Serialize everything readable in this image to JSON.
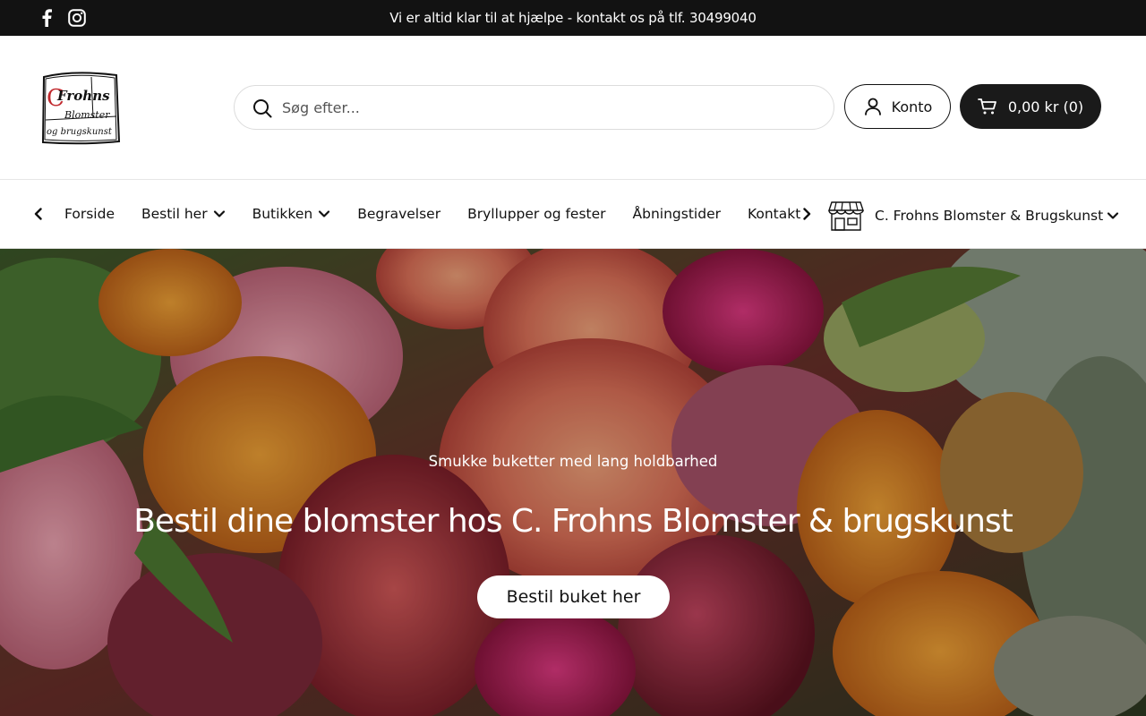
{
  "topbar": {
    "announcement": "Vi er altid klar til at hjælpe - kontakt os på tlf. 30499040",
    "social": [
      "facebook-icon",
      "instagram-icon"
    ],
    "background": "#121212"
  },
  "header": {
    "logo": {
      "line1": "Frohns",
      "line2": "Blomster",
      "line3": "og brugskunst",
      "initial": "C",
      "accent": "#c0282d"
    },
    "search": {
      "placeholder": "Søg efter..."
    },
    "account_label": "Konto",
    "cart_label": "0,00 kr (0)"
  },
  "nav": {
    "items": [
      {
        "label": "Forside",
        "has_dropdown": false
      },
      {
        "label": "Bestil her",
        "has_dropdown": true
      },
      {
        "label": "Butikken",
        "has_dropdown": true
      },
      {
        "label": "Begravelser",
        "has_dropdown": false
      },
      {
        "label": "Bryllupper og fester",
        "has_dropdown": false
      },
      {
        "label": "Åbningstider",
        "has_dropdown": false
      },
      {
        "label": "Kontakt",
        "has_dropdown": false
      }
    ],
    "store_label": "C. Frohns Blomster & Brugskunst"
  },
  "hero": {
    "subtitle": "Smukke buketter med lang holdbarhed",
    "title": "Bestil dine blomster hos C. Frohns Blomster & brugskunst",
    "cta_label": "Bestil buket her"
  }
}
